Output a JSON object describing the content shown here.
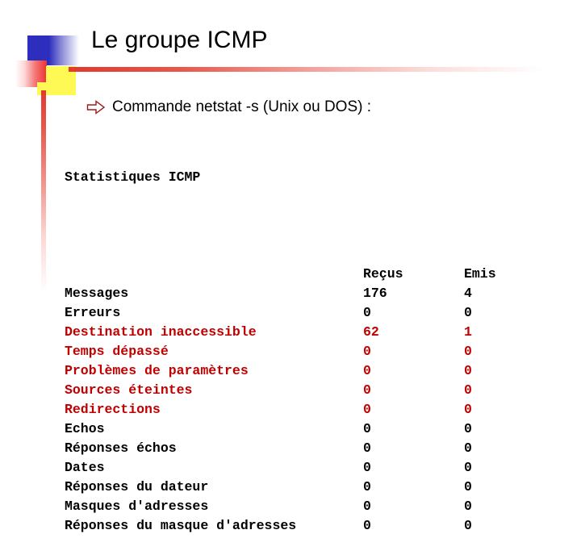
{
  "slide": {
    "title": "Le groupe ICMP",
    "bullet": {
      "icon": "arrow-right-hollow-icon",
      "text": "Commande netstat -s (Unix ou DOS) :"
    },
    "console": {
      "heading": "Statistiques ICMP",
      "columns": [
        "",
        "Reçus",
        "Emis"
      ],
      "rows": [
        {
          "label": "Messages",
          "recus": "176",
          "emis": "4",
          "color": "black"
        },
        {
          "label": "Erreurs",
          "recus": "0",
          "emis": "0",
          "color": "black"
        },
        {
          "label": "Destination inaccessible",
          "recus": "62",
          "emis": "1",
          "color": "red"
        },
        {
          "label": "Temps dépassé",
          "recus": "0",
          "emis": "0",
          "color": "red"
        },
        {
          "label": "Problèmes de paramètres",
          "recus": "0",
          "emis": "0",
          "color": "red"
        },
        {
          "label": "Sources éteintes",
          "recus": "0",
          "emis": "0",
          "color": "red"
        },
        {
          "label": "Redirections",
          "recus": "0",
          "emis": "0",
          "color": "red"
        },
        {
          "label": "Echos",
          "recus": "0",
          "emis": "0",
          "color": "black"
        },
        {
          "label": "Réponses échos",
          "recus": "0",
          "emis": "0",
          "color": "black"
        },
        {
          "label": "Dates",
          "recus": "0",
          "emis": "0",
          "color": "black"
        },
        {
          "label": "Réponses du dateur",
          "recus": "0",
          "emis": "0",
          "color": "black"
        },
        {
          "label": "Masques d'adresses",
          "recus": "0",
          "emis": "0",
          "color": "black"
        },
        {
          "label": "Réponses du masque d'adresses",
          "recus": "0",
          "emis": "0",
          "color": "black"
        }
      ]
    }
  },
  "colors": {
    "highlight_red": "#C00000",
    "rule_red": "#E23A2E",
    "deco_blue": "#2E2EBE",
    "deco_yellow": "#FFF955",
    "text_black": "#000000"
  }
}
